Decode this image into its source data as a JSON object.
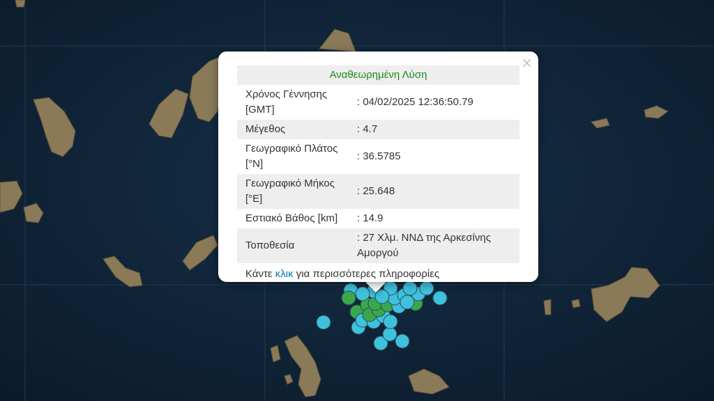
{
  "popup": {
    "title": "Αναθεωρημένη Λύση",
    "close_label": "×",
    "rows": [
      {
        "label": "Χρόνος Γέννησης [GMT]",
        "value": ": 04/02/2025 12:36:50.79"
      },
      {
        "label": "Μέγεθος",
        "value": ": 4.7"
      },
      {
        "label": "Γεωγραφικό Πλάτος [°N]",
        "value": ": 36.5785"
      },
      {
        "label": "Γεωγραφικό Μήκος [°E]",
        "value": ": 25.648"
      },
      {
        "label": "Εστιακό Βάθος [km]",
        "value": ": 14.9"
      },
      {
        "label": "Τοποθεσία",
        "value": ": 27 Χλμ. ΝΝΔ της Αρκεσίνης Αμοργού"
      }
    ],
    "footer_before": "Κάντε ",
    "footer_link": "κλικ",
    "footer_after": " για περισσότερες πληροφορίες"
  },
  "colors": {
    "sea": "#0f2233",
    "land": "#8a7a58",
    "event_recent": "#3fc1dc",
    "event_older": "#3aa84a",
    "title": "#1a8a1a",
    "link": "#0078a8"
  }
}
